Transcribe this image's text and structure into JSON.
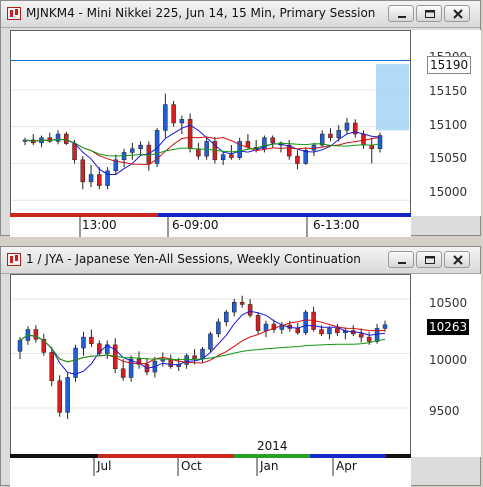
{
  "windows": [
    {
      "title": "MJNKM4 - Mini Nikkei 225, Jun 14, 15 Min, Primary Session",
      "price_axis": [
        "15200",
        "15150",
        "15100",
        "15050",
        "15000"
      ],
      "current_price": "15190",
      "time_labels": [
        "13:00",
        "6-09:00",
        "6-13:00"
      ]
    },
    {
      "title": "1 / JYA - Japanese Yen-All Sessions, Weekly Continuation",
      "price_axis": [
        "10500",
        "10000",
        "9500"
      ],
      "current_price": "10263",
      "year_label": "2014",
      "time_labels": [
        "Jul",
        "Oct",
        "Jan",
        "Apr"
      ]
    }
  ],
  "window_buttons": {
    "minimize": "minimize",
    "restore": "restore",
    "close": "close"
  },
  "colors": {
    "bull": "#1f5fd8",
    "bear": "#d42020",
    "ma_fast": "#1a1adb",
    "ma_mid": "#cc1010",
    "ma_slow": "#119911",
    "current_line": "#1a6bd6"
  },
  "chart_data": [
    {
      "type": "candlestick",
      "ylim": [
        14980,
        15230
      ],
      "candles": [
        [
          15080,
          15085,
          15075,
          15082
        ],
        [
          15082,
          15090,
          15075,
          15078
        ],
        [
          15078,
          15088,
          15072,
          15085
        ],
        [
          15085,
          15092,
          15078,
          15080
        ],
        [
          15080,
          15095,
          15076,
          15090
        ],
        [
          15090,
          15093,
          15075,
          15077
        ],
        [
          15077,
          15082,
          15050,
          15055
        ],
        [
          15055,
          15060,
          15015,
          15025
        ],
        [
          15025,
          15048,
          15018,
          15035
        ],
        [
          15035,
          15045,
          15015,
          15020
        ],
        [
          15020,
          15045,
          15015,
          15040
        ],
        [
          15040,
          15062,
          15035,
          15055
        ],
        [
          15055,
          15070,
          15045,
          15065
        ],
        [
          15065,
          15078,
          15055,
          15070
        ],
        [
          15070,
          15080,
          15060,
          15075
        ],
        [
          15075,
          15080,
          15040,
          15050
        ],
        [
          15050,
          15098,
          15045,
          15095
        ],
        [
          15095,
          15145,
          15085,
          15130
        ],
        [
          15130,
          15135,
          15100,
          15105
        ],
        [
          15105,
          15115,
          15090,
          15110
        ],
        [
          15110,
          15118,
          15065,
          15070
        ],
        [
          15070,
          15078,
          15055,
          15060
        ],
        [
          15060,
          15085,
          15055,
          15080
        ],
        [
          15080,
          15086,
          15050,
          15055
        ],
        [
          15055,
          15065,
          15048,
          15062
        ],
        [
          15062,
          15075,
          15055,
          15058
        ],
        [
          15058,
          15085,
          15055,
          15080
        ],
        [
          15080,
          15090,
          15070,
          15072
        ],
        [
          15072,
          15082,
          15065,
          15070
        ],
        [
          15070,
          15088,
          15065,
          15085
        ],
        [
          15085,
          15088,
          15072,
          15078
        ],
        [
          15078,
          15080,
          15065,
          15075
        ],
        [
          15075,
          15082,
          15055,
          15060
        ],
        [
          15060,
          15068,
          15042,
          15050
        ],
        [
          15050,
          15072,
          15048,
          15068
        ],
        [
          15068,
          15078,
          15060,
          15075
        ],
        [
          15075,
          15095,
          15072,
          15090
        ],
        [
          15090,
          15098,
          15080,
          15085
        ],
        [
          15085,
          15102,
          15080,
          15095
        ],
        [
          15095,
          15112,
          15090,
          15105
        ],
        [
          15105,
          15110,
          15085,
          15090
        ],
        [
          15090,
          15095,
          15070,
          15075
        ],
        [
          15075,
          15085,
          15050,
          15070
        ],
        [
          15070,
          15092,
          15065,
          15088
        ]
      ]
    },
    {
      "type": "candlestick",
      "ylim": [
        9060,
        10720
      ],
      "candles": [
        [
          10020,
          10150,
          9950,
          10120
        ],
        [
          10120,
          10250,
          10080,
          10220
        ],
        [
          10220,
          10260,
          10100,
          10130
        ],
        [
          10130,
          10180,
          9980,
          10010
        ],
        [
          10010,
          10060,
          9700,
          9750
        ],
        [
          9750,
          9800,
          9420,
          9460
        ],
        [
          9460,
          9820,
          9400,
          9780
        ],
        [
          9780,
          10080,
          9740,
          10050
        ],
        [
          10050,
          10200,
          9980,
          10150
        ],
        [
          10150,
          10220,
          10060,
          10090
        ],
        [
          10090,
          10120,
          9980,
          10000
        ],
        [
          10000,
          10120,
          9950,
          10080
        ],
        [
          10080,
          10140,
          9820,
          9860
        ],
        [
          9860,
          9950,
          9750,
          9780
        ],
        [
          9780,
          9980,
          9740,
          9950
        ],
        [
          9950,
          10020,
          9860,
          9900
        ],
        [
          9900,
          9960,
          9800,
          9830
        ],
        [
          9830,
          9970,
          9780,
          9930
        ],
        [
          9930,
          10010,
          9880,
          9950
        ],
        [
          9950,
          9990,
          9860,
          9880
        ],
        [
          9880,
          9960,
          9840,
          9900
        ],
        [
          9900,
          10000,
          9860,
          9980
        ],
        [
          9980,
          10040,
          9900,
          9950
        ],
        [
          9950,
          10060,
          9920,
          10040
        ],
        [
          10040,
          10200,
          10010,
          10180
        ],
        [
          10180,
          10320,
          10150,
          10290
        ],
        [
          10290,
          10400,
          10250,
          10380
        ],
        [
          10380,
          10500,
          10340,
          10470
        ],
        [
          10470,
          10530,
          10420,
          10450
        ],
        [
          10450,
          10500,
          10330,
          10350
        ],
        [
          10350,
          10380,
          10180,
          10210
        ],
        [
          10210,
          10300,
          10150,
          10270
        ],
        [
          10270,
          10310,
          10190,
          10220
        ],
        [
          10220,
          10290,
          10180,
          10260
        ],
        [
          10260,
          10300,
          10200,
          10230
        ],
        [
          10230,
          10280,
          10170,
          10190
        ],
        [
          10190,
          10400,
          10170,
          10380
        ],
        [
          10380,
          10430,
          10200,
          10220
        ],
        [
          10220,
          10260,
          10160,
          10180
        ],
        [
          10180,
          10250,
          10130,
          10230
        ],
        [
          10230,
          10270,
          10160,
          10190
        ],
        [
          10190,
          10240,
          10130,
          10210
        ],
        [
          10210,
          10260,
          10160,
          10180
        ],
        [
          10180,
          10230,
          10100,
          10150
        ],
        [
          10150,
          10200,
          10080,
          10110
        ],
        [
          10110,
          10270,
          10090,
          10230
        ],
        [
          10230,
          10300,
          10200,
          10263
        ]
      ]
    }
  ]
}
